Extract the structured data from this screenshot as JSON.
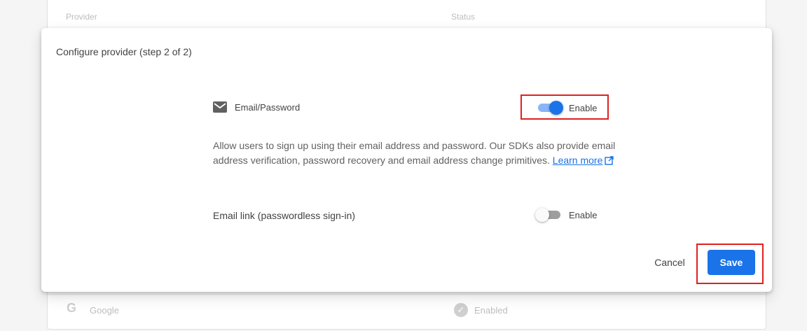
{
  "background_table": {
    "header": {
      "provider": "Provider",
      "status": "Status"
    },
    "rows": [
      {
        "icon": "google-icon",
        "name": "Google",
        "status": "Enabled",
        "status_icon": "check-circle-icon"
      }
    ]
  },
  "dialog": {
    "title": "Configure provider (step 2 of 2)",
    "provider": {
      "icon": "mail-icon",
      "name": "Email/Password"
    },
    "email_password_toggle": {
      "label": "Enable",
      "enabled": true
    },
    "description": "Allow users to sign up using their email address and password. Our SDKs also provide email address verification, password recovery and email address change primitives.",
    "learn_more_label": "Learn more",
    "passwordless": {
      "label": "Email link (passwordless sign-in)",
      "toggle_label": "Enable",
      "enabled": false
    },
    "cancel_label": "Cancel",
    "save_label": "Save"
  },
  "colors": {
    "accent": "#1a73e8",
    "highlight": "#e02020"
  }
}
